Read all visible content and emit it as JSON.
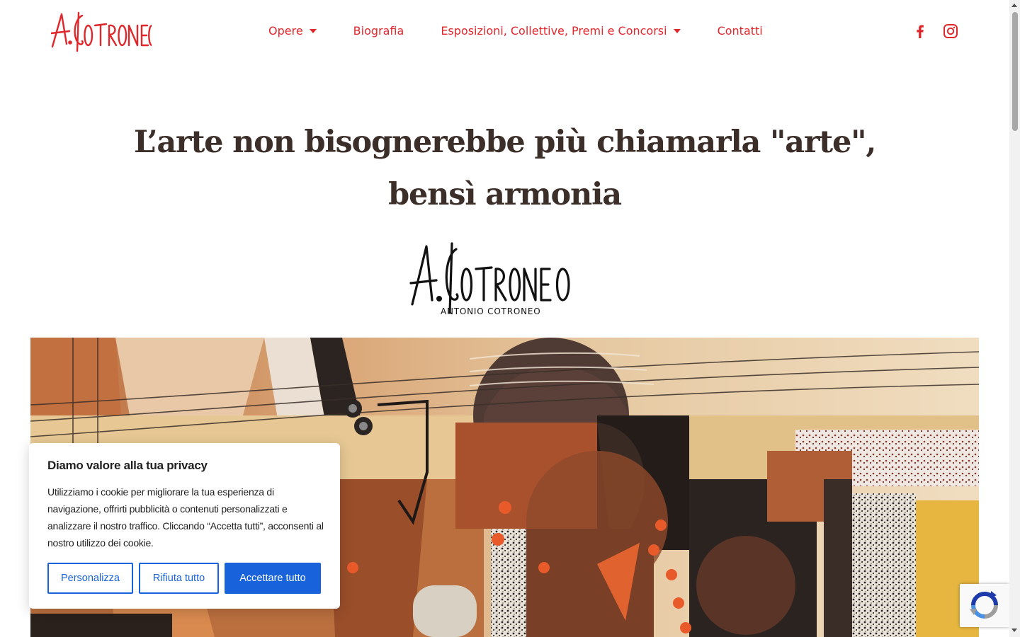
{
  "header": {
    "logo_text": "A. COTRONEO",
    "nav": [
      {
        "label": "Opere",
        "has_dropdown": true
      },
      {
        "label": "Biografia",
        "has_dropdown": false
      },
      {
        "label": "Esposizioni, Collettive, Premi e Concorsi",
        "has_dropdown": true
      },
      {
        "label": "Contatti",
        "has_dropdown": false
      }
    ],
    "social": [
      "facebook-icon",
      "instagram-icon"
    ]
  },
  "hero": {
    "quote_line1": "L’arte non bisognerebbe più chiamarla \"arte\",",
    "quote_line2": "bensì armonia",
    "signature_logo": "A. COTRONEO",
    "signature_sub": "ANTONIO COTRONEO"
  },
  "cookie_banner": {
    "title": "Diamo valore alla tua privacy",
    "text": "Utilizziamo i cookie per migliorare la tua esperienza di navigazione, offrirti pubblicità o contenuti personalizzati e analizzare il nostro traffico. Cliccando “Accetta tutti”, acconsenti al nostro utilizzo dei cookie.",
    "customize_label": "Personalizza",
    "reject_label": "Rifiuta tutto",
    "accept_label": "Accettare tutto"
  },
  "colors": {
    "brand_red": "#e0272b",
    "heading": "#3c2f2a",
    "cookie_blue": "#1863dc"
  }
}
